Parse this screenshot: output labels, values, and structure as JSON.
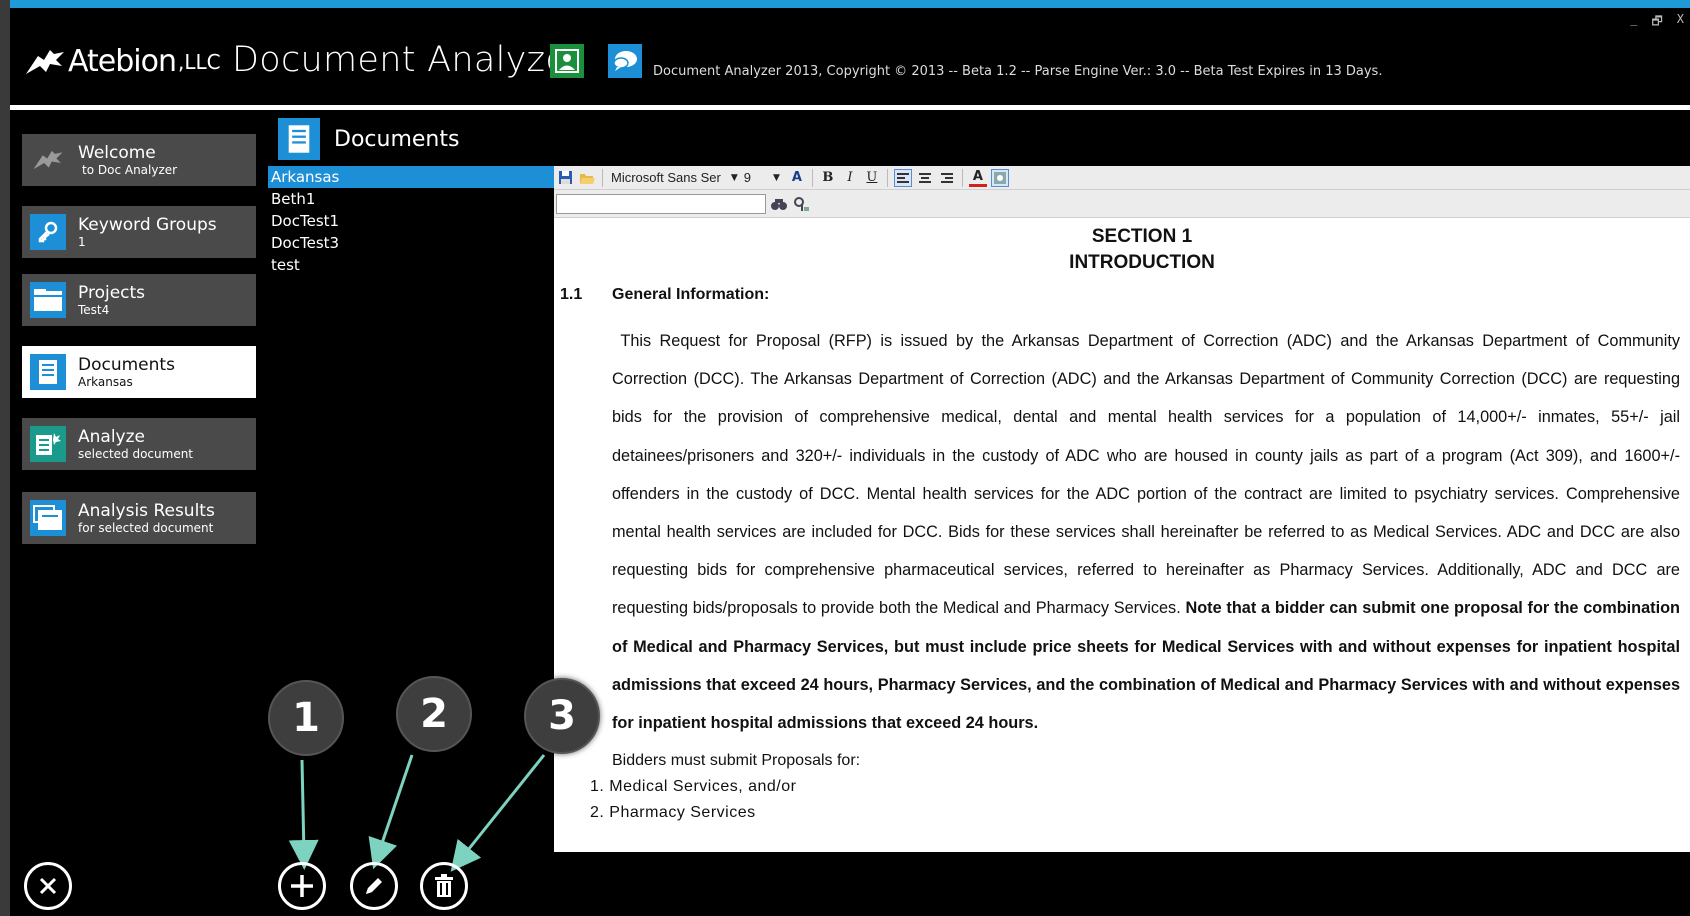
{
  "window": {
    "controls": [
      "_",
      "̴",
      "X"
    ]
  },
  "header": {
    "logo_name": "Atebion",
    "logo_suffix": ",LLC",
    "app_title": "Document Analyzer",
    "copyright": "Document Analyzer 2013, Copyright © 2013 -- Beta 1.2 -- Parse Engine Ver.: 3.0 -- Beta Test Expires in 13 Days."
  },
  "sidebar": {
    "items": [
      {
        "label": "Welcome",
        "sub": "to Doc Analyzer",
        "icon": "atebion-logo-icon"
      },
      {
        "label": "Keyword Groups",
        "sub": "1",
        "icon": "key-icon"
      },
      {
        "label": "Projects",
        "sub": "Test4",
        "icon": "folder-icon"
      },
      {
        "label": "Documents",
        "sub": "Arkansas",
        "icon": "document-icon"
      },
      {
        "label": "Analyze",
        "sub": "selected document",
        "icon": "analyze-icon"
      },
      {
        "label": "Analysis Results",
        "sub": "for selected document",
        "icon": "results-icon"
      }
    ]
  },
  "documents": {
    "title": "Documents",
    "list": [
      "Arkansas",
      "Beth1",
      "DocTest1",
      "DocTest3",
      "test"
    ],
    "selected": "Arkansas"
  },
  "editor": {
    "font_name": "Microsoft Sans Ser",
    "font_size": "9",
    "bold_label": "B",
    "italic_label": "I",
    "underline_label": "U",
    "font_color_label": "A",
    "section_line1": "SECTION 1",
    "section_line2": "INTRODUCTION",
    "subhead_num": "1.1",
    "subhead_text": "General Information:",
    "para_normal": "This Request for Proposal (RFP) is issued by the Arkansas Department of Correction (ADC) and the Arkansas Department of Community Correction (DCC). The Arkansas Department of Correction (ADC) and the Arkansas Department of Community Correction (DCC) are requesting bids for the provision of comprehensive medical, dental and mental health services for a population of 14,000+/- inmates, 55+/- jail detainees/prisoners and 320+/- individuals in the custody of ADC who are housed in county jails as part of a program (Act 309), and 1600+/- offenders in the custody of DCC. Mental health services for the ADC portion of the contract are limited to psychiatry services. Comprehensive mental health services are included for DCC. Bids for these services shall hereinafter be referred to as Medical Services. ADC and DCC are also requesting bids for comprehensive pharmaceutical services, referred to hereinafter as Pharmacy Services. Additionally, ADC and DCC are requesting bids/proposals to provide both the Medical and Pharmacy Services. ",
    "para_bold": "Note that a bidder can submit one proposal for the combination of Medical and Pharmacy Services, but must include price sheets for Medical Services with and without expenses for inpatient hospital admissions that exceed 24 hours, Pharmacy Services, and the combination of Medical and Pharmacy Services with and without expenses for inpatient hospital admissions that exceed 24 hours.",
    "bidders_line": "Bidders must submit Proposals for:",
    "list_item1": "1.  Medical Services, and/or",
    "list_item2": "2.  Pharmacy Services"
  },
  "callouts": [
    "1",
    "2",
    "3"
  ],
  "actions": {
    "add": "add-icon",
    "edit": "pencil-icon",
    "delete": "trash-icon",
    "close": "close-icon"
  }
}
